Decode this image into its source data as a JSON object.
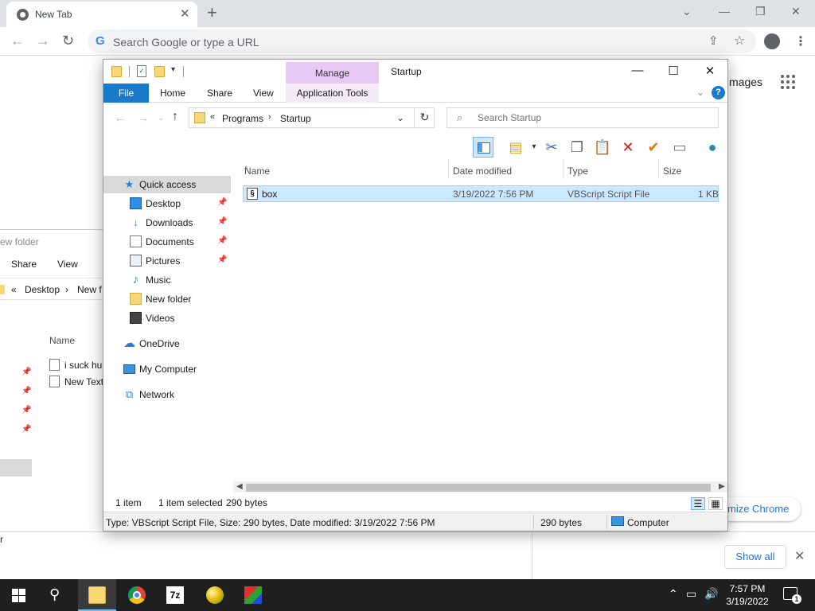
{
  "chrome": {
    "tab_title": "New Tab",
    "omnibox_placeholder": "Search Google or type a URL",
    "images_link": "mages",
    "customize_label": "mize Chrome",
    "show_all_label": "Show all",
    "download_stub": "r"
  },
  "bg_explorer": {
    "title": "ew folder",
    "ribbon_share": "Share",
    "ribbon_view": "View",
    "crumb_desktop": "Desktop",
    "crumb_new": "New f",
    "col_name": "Name",
    "files": [
      "i suck hu",
      "New Text"
    ]
  },
  "explorer": {
    "title": "Startup",
    "manage_tab": "Manage",
    "ribbon_tabs": {
      "file": "File",
      "home": "Home",
      "share": "Share",
      "view": "View",
      "app_tools": "Application Tools"
    },
    "breadcrumb": [
      "Programs",
      "Startup"
    ],
    "search_placeholder": "Search Startup",
    "nav": {
      "quick_access": "Quick access",
      "desktop": "Desktop",
      "downloads": "Downloads",
      "documents": "Documents",
      "pictures": "Pictures",
      "music": "Music",
      "new_folder": "New folder",
      "videos": "Videos",
      "onedrive": "OneDrive",
      "my_computer": "My Computer",
      "network": "Network"
    },
    "columns": {
      "name": "Name",
      "date": "Date modified",
      "type": "Type",
      "size": "Size"
    },
    "file": {
      "name": "box",
      "date": "3/19/2022 7:56 PM",
      "type": "VBScript Script File",
      "size": "1 KB"
    },
    "status": {
      "count": "1 item",
      "selected": "1 item selected",
      "bytes": "290 bytes"
    },
    "info": {
      "details": "Type: VBScript Script File, Size: 290 bytes, Date modified: 3/19/2022 7:56 PM",
      "size": "290 bytes",
      "location": "Computer"
    }
  },
  "taskbar": {
    "app_7z": "7z",
    "time": "7:57 PM",
    "date": "3/19/2022",
    "notification_count": "1"
  }
}
